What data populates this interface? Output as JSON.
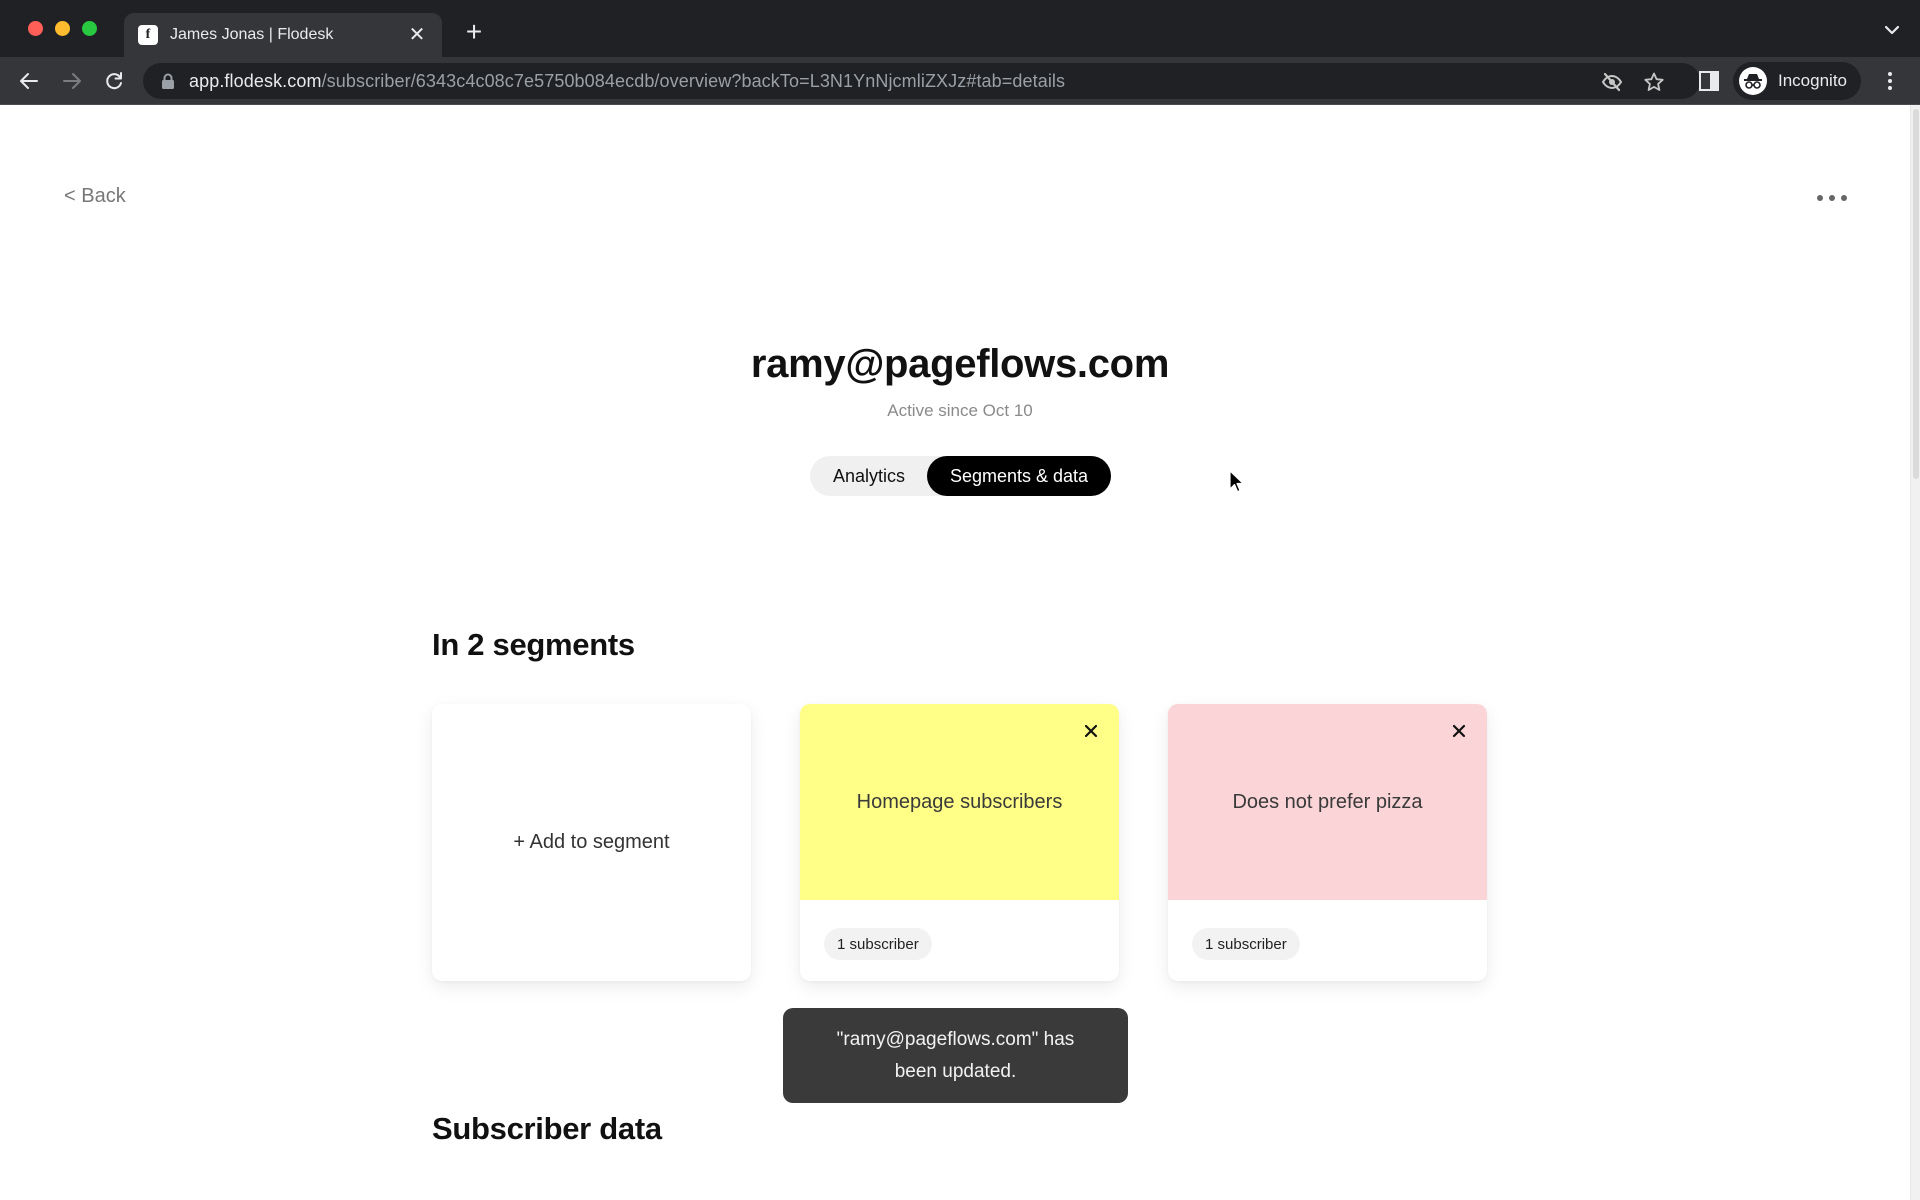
{
  "browser": {
    "tab": {
      "title": "James Jonas | Flodesk",
      "favicon": "flodesk-logo"
    },
    "new_tab_label": "+",
    "url_host": "app.flodesk.com",
    "url_path": "/subscriber/6343c4c08c7e5750b084ecdb/overview?backTo=L3N1YnNjcmliZXJz#tab=details",
    "profile_label": "Incognito"
  },
  "page": {
    "back_label": "< Back",
    "title": "ramy@pageflows.com",
    "subtitle": "Active since Oct 10",
    "tabs": [
      {
        "label": "Analytics",
        "active": false
      },
      {
        "label": "Segments & data",
        "active": true
      }
    ],
    "segments_heading": "In 2 segments",
    "add_segment_label": "+ Add to segment",
    "segments": [
      {
        "name": "Homepage subscribers",
        "count": "1 subscriber",
        "color": "#ffff88"
      },
      {
        "name": "Does not prefer pizza",
        "count": "1 subscriber",
        "color": "#fad4d6"
      }
    ],
    "subscriber_data_heading": "Subscriber data"
  },
  "toast": {
    "message": "\"ramy@pageflows.com\" has been updated."
  }
}
